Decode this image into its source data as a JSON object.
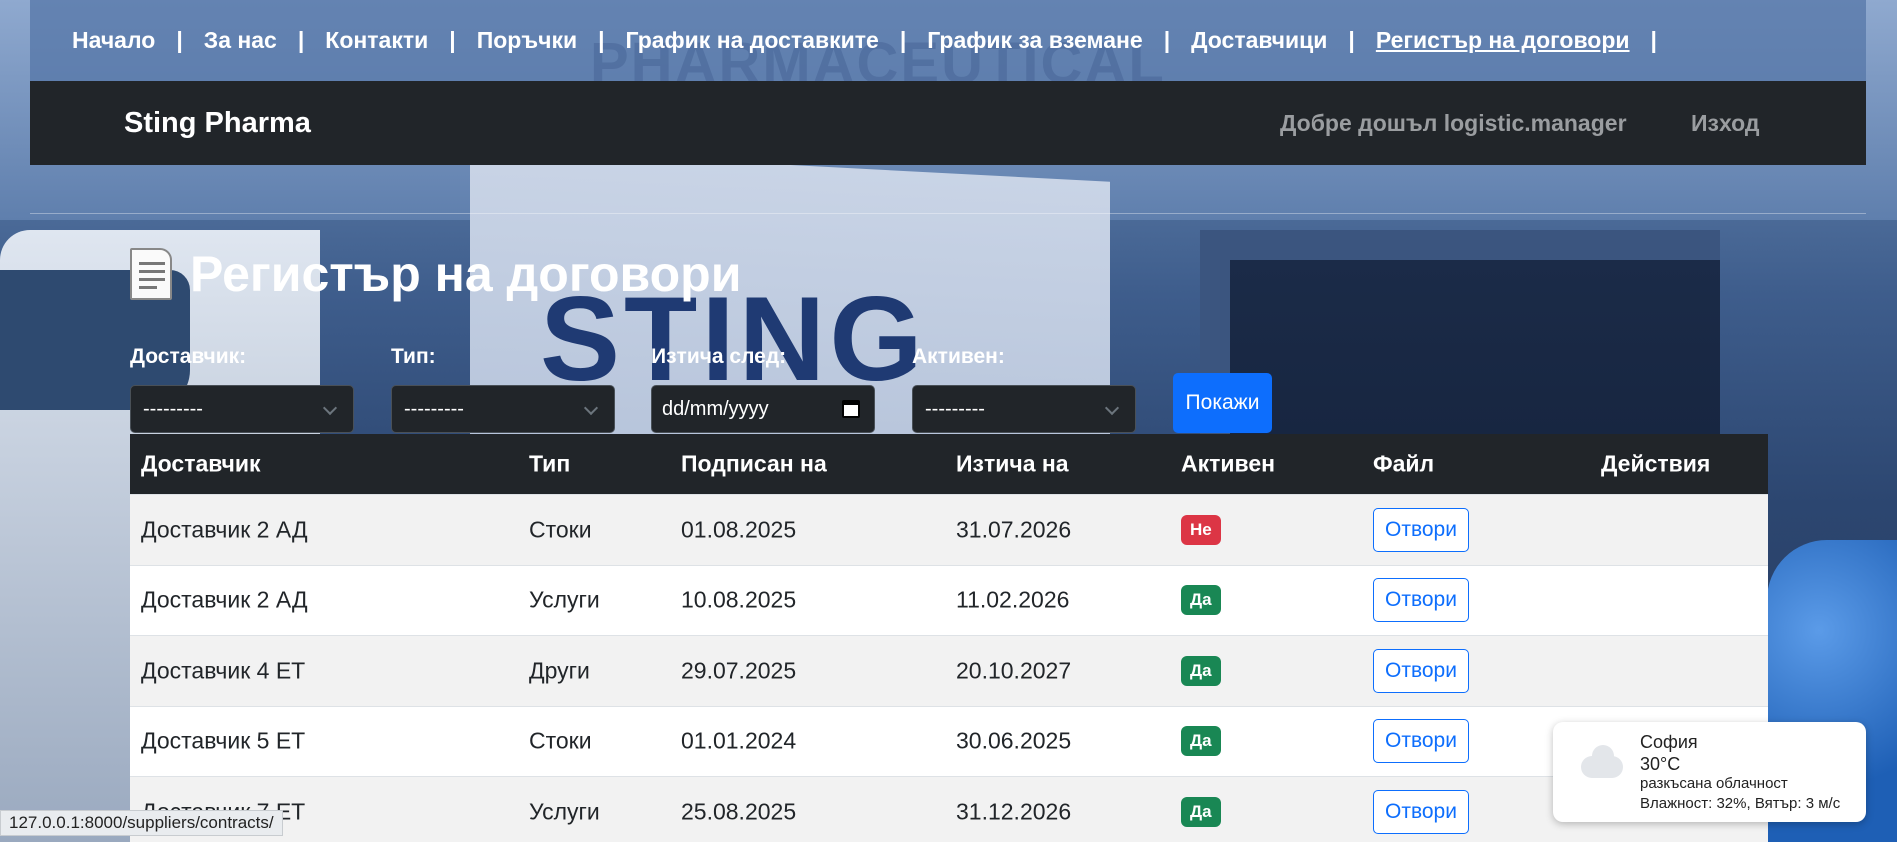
{
  "topnav": {
    "items": [
      "Начало",
      "За нас",
      "Контакти",
      "Поръчки",
      "График на доставките",
      "График за вземане",
      "Доставчици",
      "Регистър на договори"
    ],
    "separator": "|"
  },
  "navbar": {
    "brand": "Sting Pharma",
    "welcome": "Добре дошъл logistic.manager",
    "logout": "Изход"
  },
  "page": {
    "title": "Регистър на договори",
    "icon": "document-icon"
  },
  "filters": {
    "supplier_label": "Доставчик:",
    "supplier_value": "---------",
    "type_label": "Тип:",
    "type_value": "---------",
    "expires_label": "Изтича след:",
    "expires_value": "dd/mm/yyyy",
    "active_label": "Активен:",
    "active_value": "---------",
    "show_button": "Покажи"
  },
  "table": {
    "headers": [
      "Доставчик",
      "Тип",
      "Подписан на",
      "Изтича на",
      "Активен",
      "Файл",
      "Действия"
    ],
    "rows": [
      {
        "supplier": "Доставчик 2 АД",
        "type": "Стоки",
        "signed": "01.08.2025",
        "expires": "31.07.2026",
        "active": "Не",
        "file": "Отвори"
      },
      {
        "supplier": "Доставчик 2 АД",
        "type": "Услуги",
        "signed": "10.08.2025",
        "expires": "11.02.2026",
        "active": "Да",
        "file": "Отвори"
      },
      {
        "supplier": "Доставчик 4 ЕТ",
        "type": "Други",
        "signed": "29.07.2025",
        "expires": "20.10.2027",
        "active": "Да",
        "file": "Отвори"
      },
      {
        "supplier": "Доставчик 5 ЕТ",
        "type": "Стоки",
        "signed": "01.01.2024",
        "expires": "30.06.2025",
        "active": "Да",
        "file": "Отвори"
      },
      {
        "supplier": "Доставчик 7 ЕТ",
        "type": "Услуги",
        "signed": "25.08.2025",
        "expires": "31.12.2026",
        "active": "Да",
        "file": "Отвори"
      }
    ]
  },
  "weather": {
    "city": "София",
    "temp": "30°C",
    "description": "разкъсана облачност",
    "details": "Влажност: 32%, Вятър: 3 м/с",
    "icon": "cloud-icon"
  },
  "status_bar": {
    "url": "127.0.0.1:8000/suppliers/contracts/"
  },
  "colors": {
    "primary": "#0d6efd",
    "danger": "#dc3545",
    "success": "#198754",
    "dark": "#212529"
  }
}
